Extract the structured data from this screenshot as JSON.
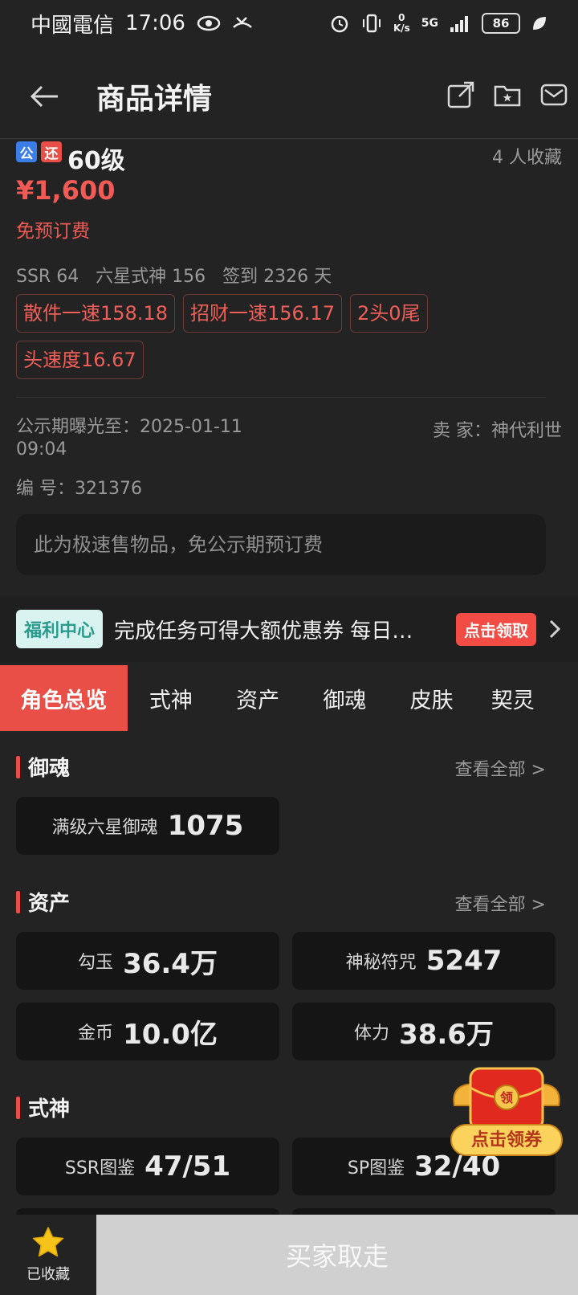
{
  "status_bar": {
    "carrier": "中國電信",
    "time": "17:06",
    "net_speed_value": "0",
    "net_speed_unit": "K/s",
    "signal": "5G",
    "battery": "86"
  },
  "header": {
    "title": "商品详情"
  },
  "item": {
    "badge_public": "公",
    "badge_return": "还",
    "level": "60级",
    "favorites": "4 人收藏",
    "price": "¥1,600",
    "fee_note": "免预订费",
    "meta": "SSR 64   六星式神 156   签到 2326 天",
    "tags": [
      "散件一速158.18",
      "招财一速156.17",
      "2头0尾",
      "头速度16.67"
    ],
    "publish_until_label": "公示期曝光至：",
    "publish_until_date": "2025-01-11",
    "publish_until_time": "09:04",
    "seller_label": "卖 家：",
    "seller_name": "神代利世",
    "serial_label": "编 号：",
    "serial_value": "321376",
    "notice": "此为极速售物品，免公示期预订费"
  },
  "welfare": {
    "pill": "福利中心",
    "text": "完成任务可得大额优惠券 每日…",
    "claim": "点击领取"
  },
  "tabs": [
    "角色总览",
    "式神",
    "资产",
    "御魂",
    "皮肤",
    "契灵"
  ],
  "sections": {
    "yuhun": {
      "title": "御魂",
      "see_all": "查看全部 >",
      "cards": [
        {
          "label": "满级六星御魂",
          "value": "1075"
        }
      ]
    },
    "assets": {
      "title": "资产",
      "see_all": "查看全部 >",
      "cards": [
        {
          "label": "勾玉",
          "value": "36.4万"
        },
        {
          "label": "神秘符咒",
          "value": "5247"
        },
        {
          "label": "金币",
          "value": "10.0亿"
        },
        {
          "label": "体力",
          "value": "38.6万"
        }
      ]
    },
    "shikigami": {
      "title": "式神",
      "cards": [
        {
          "label": "SSR图鉴",
          "value": "47/51"
        },
        {
          "label": "SP图鉴",
          "value": "32/40"
        }
      ]
    }
  },
  "red_packet": {
    "seal": "领",
    "label": "点击领券"
  },
  "bottom": {
    "fav_label": "已收藏",
    "buy_label": "买家取走"
  },
  "colors": {
    "accent_red": "#e94e47",
    "price_red": "#f15a55",
    "bg": "#232323",
    "card_bg": "#151515"
  }
}
